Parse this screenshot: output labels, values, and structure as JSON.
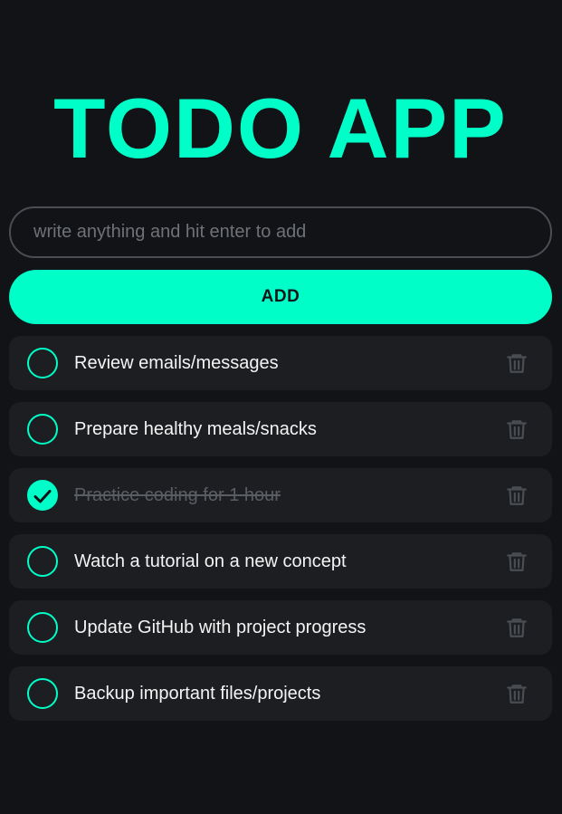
{
  "app": {
    "title": "TODO APP"
  },
  "input": {
    "value": "",
    "placeholder": "write anything and hit enter to add"
  },
  "add_button": {
    "label": "ADD"
  },
  "todos": [
    {
      "text": "Review emails/messages",
      "completed": false
    },
    {
      "text": "Prepare healthy meals/snacks",
      "completed": false
    },
    {
      "text": "Practice coding for 1 hour",
      "completed": true
    },
    {
      "text": "Watch a tutorial on a new concept",
      "completed": false
    },
    {
      "text": "Update GitHub with project progress",
      "completed": false
    },
    {
      "text": "Backup important files/projects",
      "completed": false
    }
  ],
  "icons": {
    "check": "circle-check-icon",
    "delete": "trash-icon"
  },
  "colors": {
    "background": "#111316",
    "accent": "#00ffc8",
    "item_background": "#1c1e22",
    "input_border": "#4a4d52",
    "placeholder": "#6e7176",
    "text": "#f4f4f4",
    "completed_text": "#5a5d62",
    "trash_icon": "#4a4d52"
  }
}
